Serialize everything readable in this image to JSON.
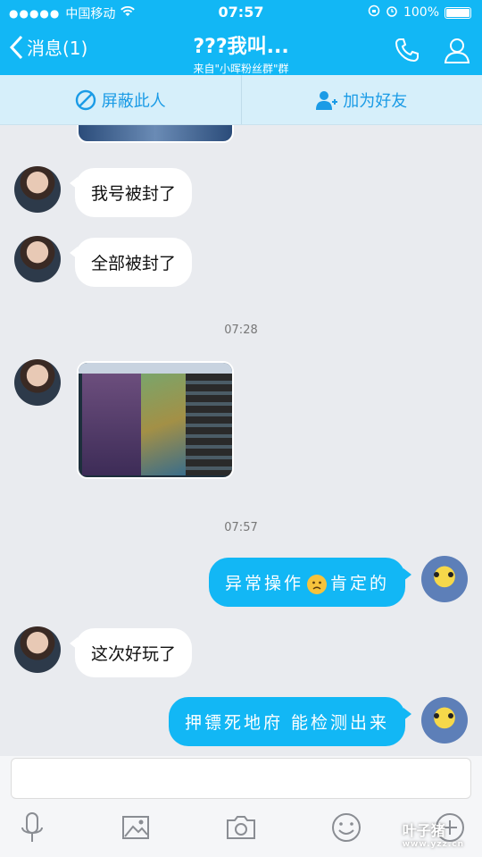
{
  "status_bar": {
    "carrier": "中国移动",
    "time": "07:57",
    "battery": "100%"
  },
  "nav": {
    "back_label": "消息(1)",
    "title": "???我叫...",
    "subtitle": "来自\"小晖粉丝群\"群"
  },
  "actions": {
    "block_label": "屏蔽此人",
    "add_friend_label": "加为好友"
  },
  "messages": [
    {
      "side": "left",
      "type": "text",
      "text": "我号被封了"
    },
    {
      "side": "left",
      "type": "text",
      "text": "全部被封了"
    },
    {
      "type": "timestamp",
      "text": "07:28"
    },
    {
      "side": "left",
      "type": "image",
      "alt": "game screenshot"
    },
    {
      "type": "timestamp",
      "text": "07:57"
    },
    {
      "side": "right",
      "type": "text",
      "text_before": "异常操作",
      "text_after": "肯定的",
      "emoji": "sad-face"
    },
    {
      "side": "left",
      "type": "text",
      "text": "这次好玩了"
    },
    {
      "side": "right",
      "type": "text",
      "text": "押镖死地府 能检测出来"
    }
  ],
  "watermark": {
    "logo": "叶子猪",
    "site": "www.yzz.cn"
  },
  "colors": {
    "header": "#12b7f5",
    "action_bar": "#d6effa",
    "background": "#e9ebef",
    "bubble_out": "#12b7f5"
  }
}
